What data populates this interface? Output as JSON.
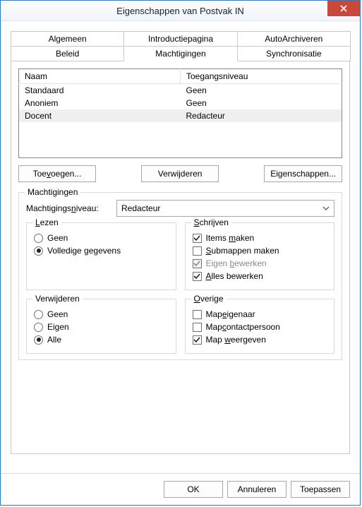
{
  "window": {
    "title": "Eigenschappen van Postvak IN"
  },
  "tabs": {
    "row1": [
      "Algemeen",
      "Introductiepagina",
      "AutoArchiveren"
    ],
    "row2": [
      "Beleid",
      "Machtigingen",
      "Synchronisatie"
    ],
    "active": "Machtigingen"
  },
  "table": {
    "headers": [
      "Naam",
      "Toegangsniveau"
    ],
    "rows": [
      {
        "name": "Standaard",
        "level": "Geen",
        "selected": false
      },
      {
        "name": "Anoniem",
        "level": "Geen",
        "selected": false
      },
      {
        "name": "Docent",
        "level": "Redacteur",
        "selected": true
      }
    ]
  },
  "buttons": {
    "add": "Toevoegen...",
    "remove": "Verwijderen",
    "props": "Eigenschappen..."
  },
  "permissions": {
    "group_label": "Machtigingen",
    "level_label": "Machtigingsniveau:",
    "level_value": "Redacteur",
    "read": {
      "legend": "Lezen",
      "none": "Geen",
      "full": "Volledige gegevens",
      "selected": "full"
    },
    "write": {
      "legend": "Schrijven",
      "create_items": {
        "label": "Items maken",
        "checked": true
      },
      "create_subfolders": {
        "label": "Submappen maken",
        "checked": false
      },
      "edit_own": {
        "label": "Eigen bewerken",
        "checked": true,
        "disabled": true
      },
      "edit_all": {
        "label": "Alles bewerken",
        "checked": true
      }
    },
    "delete": {
      "legend": "Verwijderen",
      "none": "Geen",
      "own": "Eigen",
      "all": "Alle",
      "selected": "all"
    },
    "other": {
      "legend": "Overige",
      "folder_owner": {
        "label": "Mapeigenaar",
        "checked": false
      },
      "folder_contact": {
        "label": "Mapcontactpersoon",
        "checked": false
      },
      "folder_visible": {
        "label": "Map weergeven",
        "checked": true
      }
    }
  },
  "footer": {
    "ok": "OK",
    "cancel": "Annuleren",
    "apply": "Toepassen"
  }
}
